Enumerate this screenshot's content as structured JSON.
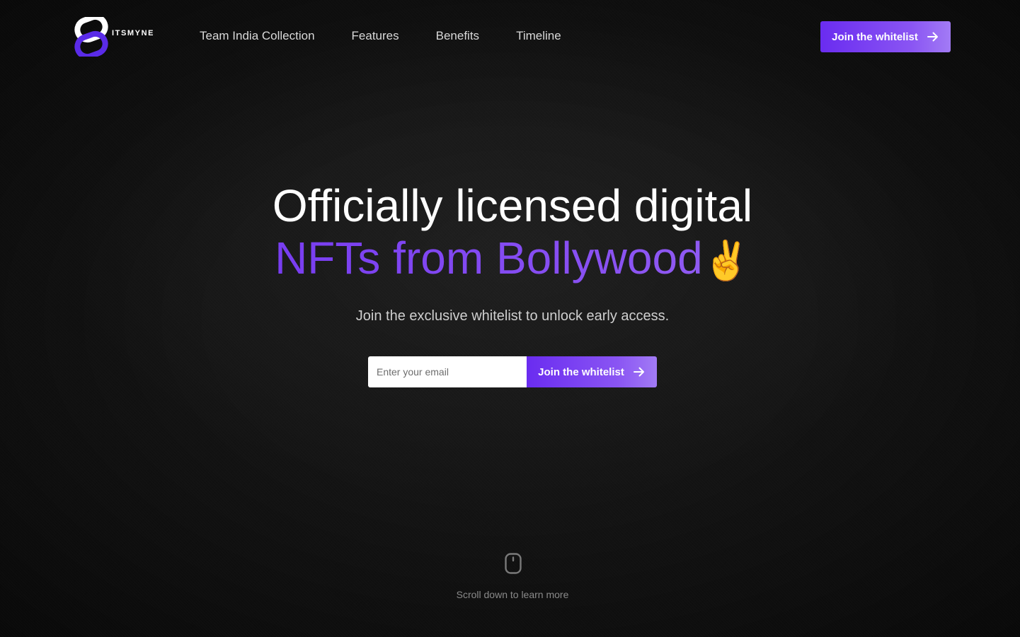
{
  "brand": {
    "name": "ITSMYNE",
    "logo_icon": "infinity-link-logo",
    "colors": {
      "accent": "#6a2cf0",
      "accent_light": "#a27bf5",
      "logo_dark": "#2e1fb0"
    }
  },
  "nav": {
    "items": [
      {
        "label": "Team India Collection"
      },
      {
        "label": "Features"
      },
      {
        "label": "Benefits"
      },
      {
        "label": "Timeline"
      }
    ]
  },
  "header": {
    "cta_label": "Join the whitelist",
    "cta_icon": "arrow-right-icon"
  },
  "hero": {
    "title_line1": "Officially licensed digital",
    "title_line2": "NFTs from Bollywood",
    "title_emoji": "✌",
    "subtitle": "Join the exclusive whitelist to unlock early access."
  },
  "signup": {
    "email_placeholder": "Enter your email",
    "email_value": "",
    "button_label": "Join the whitelist",
    "button_icon": "arrow-right-icon"
  },
  "scroll_hint": {
    "icon": "mouse-icon",
    "label": "Scroll down to learn more"
  }
}
